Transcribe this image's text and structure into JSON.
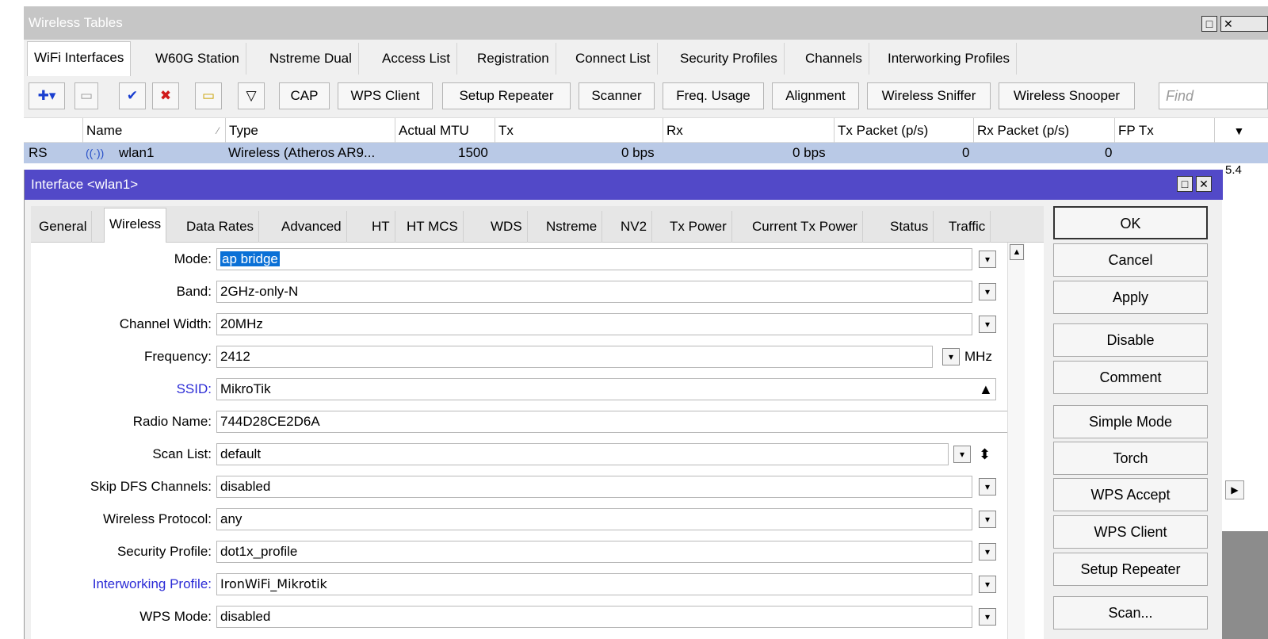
{
  "window": {
    "title": "Wireless Tables"
  },
  "tabs": [
    {
      "label": "WiFi Interfaces"
    },
    {
      "label": "W60G Station"
    },
    {
      "label": "Nstreme Dual"
    },
    {
      "label": "Access List"
    },
    {
      "label": "Registration"
    },
    {
      "label": "Connect List"
    },
    {
      "label": "Security Profiles"
    },
    {
      "label": "Channels"
    },
    {
      "label": "Interworking Profiles"
    }
  ],
  "toolbar": {
    "buttons": [
      {
        "label": "CAP"
      },
      {
        "label": "WPS Client"
      },
      {
        "label": "Setup Repeater"
      },
      {
        "label": "Scanner"
      },
      {
        "label": "Freq. Usage"
      },
      {
        "label": "Alignment"
      },
      {
        "label": "Wireless Sniffer"
      },
      {
        "label": "Wireless Snooper"
      }
    ],
    "find_placeholder": "Find"
  },
  "table": {
    "columns": [
      "Name",
      "Type",
      "Actual MTU",
      "Tx",
      "Rx",
      "Tx Packet (p/s)",
      "Rx Packet (p/s)",
      "FP Tx"
    ],
    "row": {
      "flags": "RS",
      "name": "wlan1",
      "type": "Wireless (Atheros AR9...",
      "mtu": "1500",
      "tx": "0 bps",
      "rx": "0 bps",
      "tx_pps": "0",
      "rx_pps": "0"
    }
  },
  "dialog": {
    "title": "Interface <wlan1>",
    "tabs": [
      {
        "label": "General"
      },
      {
        "label": "Wireless"
      },
      {
        "label": "Data Rates"
      },
      {
        "label": "Advanced"
      },
      {
        "label": "HT"
      },
      {
        "label": "HT MCS"
      },
      {
        "label": "WDS"
      },
      {
        "label": "Nstreme"
      },
      {
        "label": "NV2"
      },
      {
        "label": "Tx Power"
      },
      {
        "label": "Current Tx Power"
      },
      {
        "label": "Status"
      },
      {
        "label": "Traffic"
      }
    ],
    "fields": [
      {
        "label": "Mode:",
        "value": "ap bridge"
      },
      {
        "label": "Band:",
        "value": "2GHz-only-N"
      },
      {
        "label": "Channel Width:",
        "value": "20MHz"
      },
      {
        "label": "Frequency:",
        "value": "2412",
        "unit": "MHz"
      },
      {
        "label": "SSID:",
        "value": "MikroTik"
      },
      {
        "label": "Radio Name:",
        "value": "744D28CE2D6A"
      },
      {
        "label": "Scan List:",
        "value": "default"
      },
      {
        "label": "Skip DFS Channels:",
        "value": "disabled"
      },
      {
        "label": "Wireless Protocol:",
        "value": "any"
      },
      {
        "label": "Security Profile:",
        "value": "dot1x_profile"
      },
      {
        "label": "Interworking Profile:",
        "value": "IronWiFi_Mikrotik"
      },
      {
        "label": "WPS Mode:",
        "value": "disabled"
      }
    ],
    "buttons": [
      {
        "label": "OK"
      },
      {
        "label": "Cancel"
      },
      {
        "label": "Apply"
      },
      {
        "label": "Disable"
      },
      {
        "label": "Comment"
      },
      {
        "label": "Simple Mode"
      },
      {
        "label": "Torch"
      },
      {
        "label": "WPS Accept"
      },
      {
        "label": "WPS Client"
      },
      {
        "label": "Setup Repeater"
      },
      {
        "label": "Scan..."
      }
    ]
  },
  "side_partial_text": "5.4",
  "colors": {
    "dialog_title": "#5249c8",
    "selected_row": "#b9c9e6",
    "link_label": "#2b2bd6",
    "selection": "#0a70d6"
  }
}
